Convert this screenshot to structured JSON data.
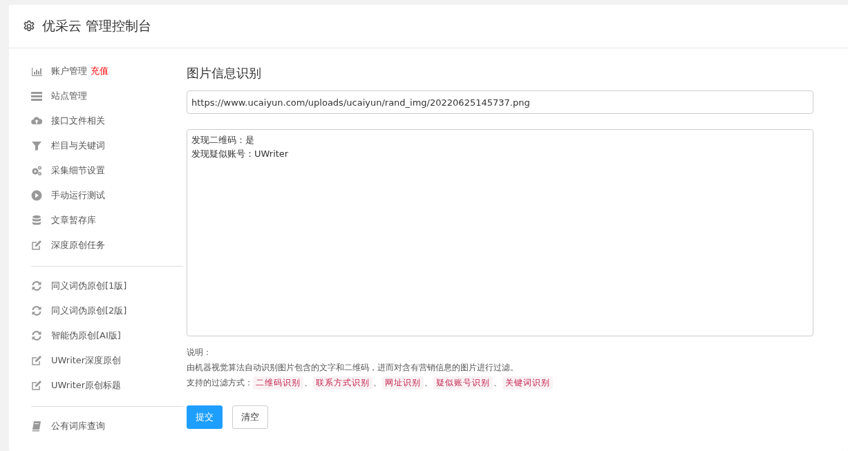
{
  "header": {
    "title": "优采云 管理控制台"
  },
  "sidebar": {
    "groups": [
      {
        "items": [
          {
            "kind": "bars",
            "label": "账户管理",
            "badge": "充值"
          },
          {
            "kind": "server",
            "label": "站点管理"
          },
          {
            "kind": "cloud",
            "label": "接口文件相关"
          },
          {
            "kind": "filter",
            "label": "栏目与关键词"
          },
          {
            "kind": "gears",
            "label": "采集细节设置"
          },
          {
            "kind": "play",
            "label": "手动运行测试"
          },
          {
            "kind": "database",
            "label": "文章暂存库"
          },
          {
            "kind": "edit",
            "label": "深度原创任务"
          }
        ]
      },
      {
        "items": [
          {
            "kind": "refresh",
            "label": "同义词伪原创[1版]"
          },
          {
            "kind": "refresh",
            "label": "同义词伪原创[2版]"
          },
          {
            "kind": "refresh",
            "label": "智能伪原创[AI版]"
          },
          {
            "kind": "edit",
            "label": "UWriter深度原创"
          },
          {
            "kind": "edit",
            "label": "UWriter原创标题"
          }
        ]
      },
      {
        "items": [
          {
            "kind": "book",
            "label": "公有词库查询"
          }
        ]
      }
    ]
  },
  "main": {
    "title": "图片信息识别",
    "url_field": {
      "value": "https://www.ucaiyun.com/uploads/ucaiyun/rand_img/20220625145737.png"
    },
    "result_box": {
      "lines": [
        "发现二维码：是",
        "发现疑似账号：UWriter"
      ]
    },
    "note_heading": "说明：",
    "note_text": "由机器视觉算法自动识别图片包含的文字和二维码，进而对含有营销信息的图片进行过滤。",
    "methods_label": "支持的过滤方式：",
    "methods": [
      "二维码识别",
      "联系方式识别",
      "网址识别",
      "疑似账号识别",
      "关键词识别"
    ],
    "separator": "、",
    "buttons": [
      {
        "label": "提交",
        "kind": "primary"
      },
      {
        "label": "清空",
        "kind": "default"
      }
    ]
  }
}
